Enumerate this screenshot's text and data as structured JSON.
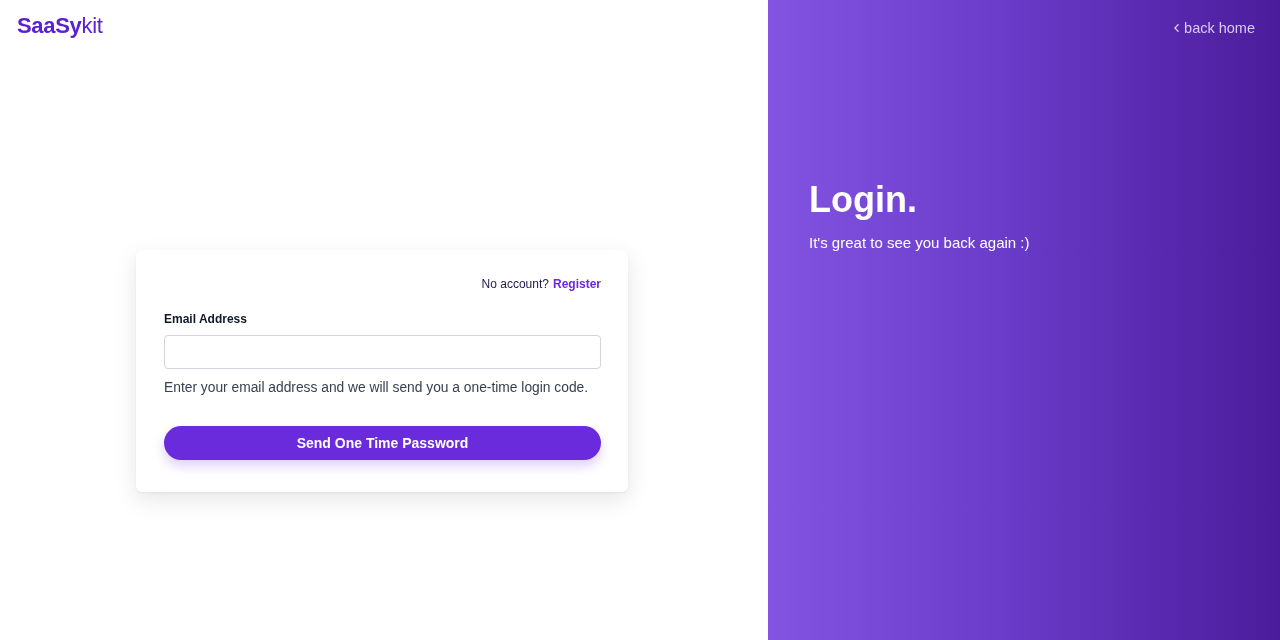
{
  "logo": "**SaaSy**kit",
  "back_link": {
    "label": "back home"
  },
  "card": {
    "prompt": "No account?",
    "register_link": "Register",
    "email_field": {
      "label": "Email Address"
    },
    "helper": "Enter your email address and we will send you a one-time login code.",
    "submit_button": "Send One Time Password"
  },
  "hero": {
    "title": "Login.",
    "subtitle": "It's great to see you back again :)"
  }
}
